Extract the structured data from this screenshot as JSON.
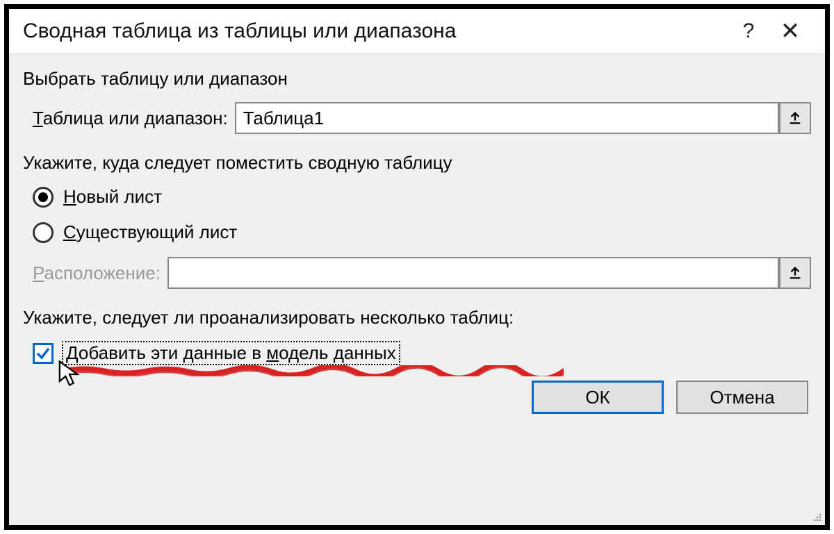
{
  "titlebar": {
    "title": "Сводная таблица из таблицы или диапазона",
    "help_icon": "?",
    "close_icon": "✕"
  },
  "section1": {
    "heading": "Выбрать таблицу или диапазон",
    "label_before": "Т",
    "label_after": "аблица или диапазон:",
    "input_value": "Таблица1"
  },
  "section2": {
    "heading": "Укажите, куда следует поместить сводную таблицу",
    "radio1_before": "Н",
    "radio1_after": "овый лист",
    "radio2_before": "С",
    "radio2_after": "уществующий лист",
    "location_before": "Р",
    "location_after": "асположение:",
    "location_value": ""
  },
  "section3": {
    "heading": "Укажите, следует ли проанализировать несколько таблиц:",
    "cb_before": "Добавить эти данные в ",
    "cb_accel": "м",
    "cb_after": "одель данных"
  },
  "footer": {
    "ok": "ОК",
    "cancel": "Отмена"
  }
}
